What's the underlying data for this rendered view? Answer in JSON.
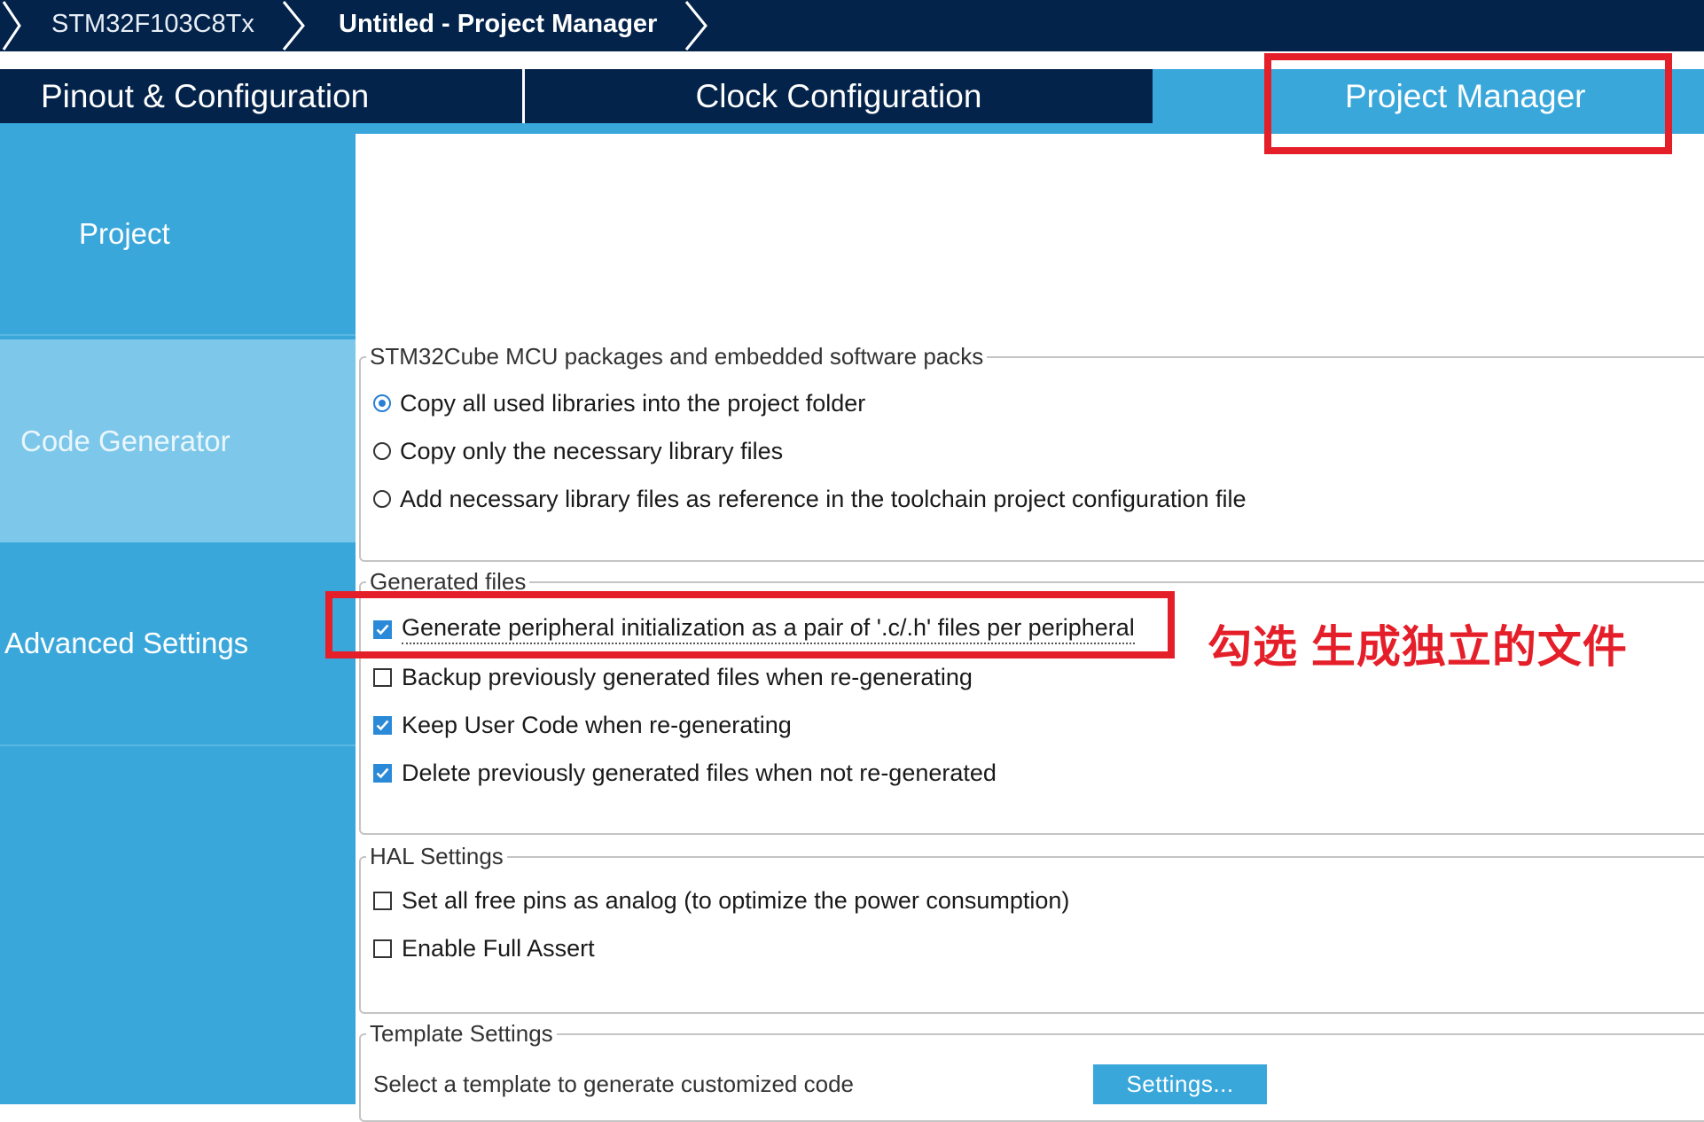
{
  "breadcrumb": {
    "device": "STM32F103C8Tx",
    "project": "Untitled - Project Manager"
  },
  "tabs": [
    {
      "label": "Pinout & Configuration"
    },
    {
      "label": "Clock Configuration"
    },
    {
      "label": "Project Manager",
      "active": true
    }
  ],
  "sidebar": {
    "items": [
      {
        "label": "Project"
      },
      {
        "label": "Code Generator",
        "selected": true
      },
      {
        "label": "Advanced Settings"
      }
    ]
  },
  "packages": {
    "legend": "STM32Cube MCU packages and embedded software packs",
    "options": [
      {
        "label": "Copy all used libraries into the project folder",
        "selected": true
      },
      {
        "label": "Copy only the necessary library files",
        "selected": false
      },
      {
        "label": "Add necessary library files as reference in the toolchain project configuration file",
        "selected": false
      }
    ]
  },
  "generated_files": {
    "legend": "Generated files",
    "options": [
      {
        "label": "Generate peripheral initialization as a pair of '.c/.h' files per peripheral",
        "checked": true
      },
      {
        "label": "Backup previously generated files when re-generating",
        "checked": false
      },
      {
        "label": "Keep User Code when re-generating",
        "checked": true
      },
      {
        "label": "Delete previously generated files when not re-generated",
        "checked": true
      }
    ]
  },
  "hal_settings": {
    "legend": "HAL Settings",
    "options": [
      {
        "label": "Set all free pins as analog (to optimize the power consumption)",
        "checked": false
      },
      {
        "label": "Enable Full Assert",
        "checked": false
      }
    ]
  },
  "template_settings": {
    "legend": "Template Settings",
    "text": "Select a template to generate customized code",
    "button": "Settings..."
  },
  "annotation": {
    "note": "勾选 生成独立的文件",
    "color": "#e51f2a"
  },
  "colors": {
    "navy": "#03234b",
    "accent": "#3aa7db",
    "sidebar_selected": "#7dc8ea",
    "checkbox": "#2a8ad8"
  }
}
